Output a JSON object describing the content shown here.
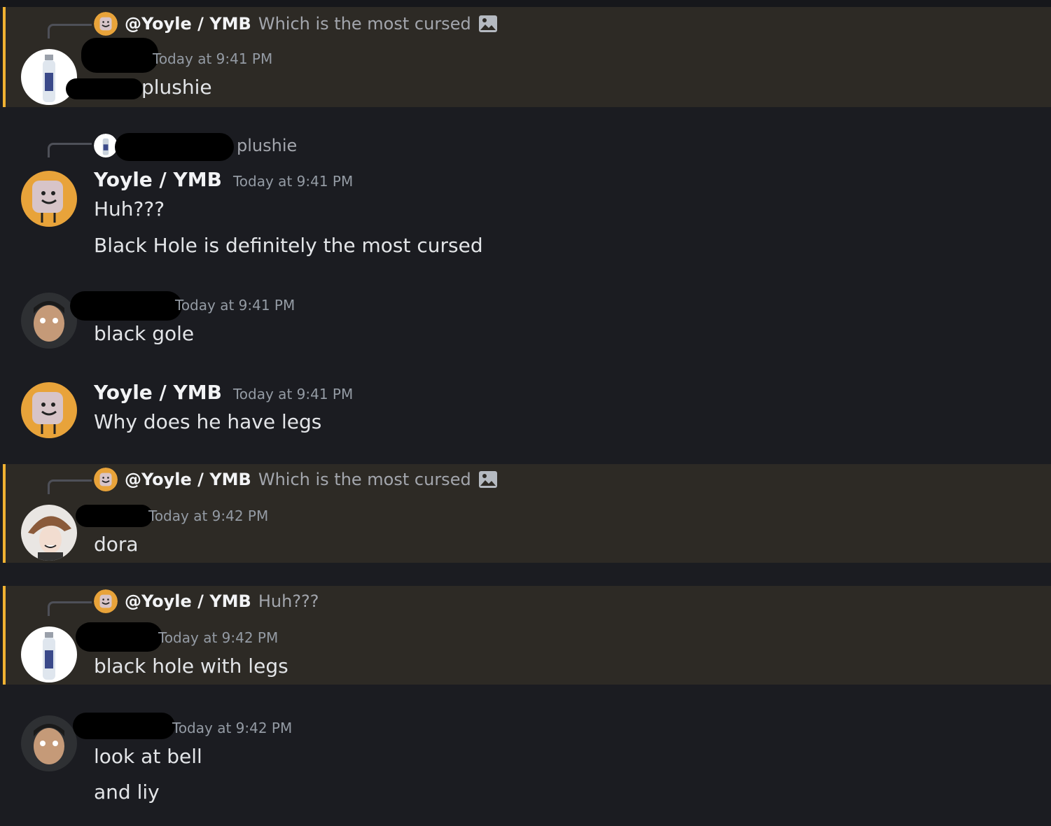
{
  "messages": [
    {
      "reply": {
        "mention": "@Yoyle / YMB",
        "text": "Which is the most cursed",
        "attachment_icon": "image-icon"
      },
      "timestamp": "Today at 9:41 PM",
      "lines": [
        "plushie"
      ],
      "highlighted": true,
      "avatar": "water-bottle-avatar"
    },
    {
      "reply": {
        "text": "plushie"
      },
      "author": "Yoyle / YMB",
      "timestamp": "Today at 9:41 PM",
      "lines": [
        "Huh???",
        "Black Hole is definitely the most cursed"
      ],
      "avatar": "yoyle-avatar"
    },
    {
      "timestamp": "Today at 9:41 PM",
      "lines": [
        "black gole"
      ],
      "avatar": "person-avatar"
    },
    {
      "author": "Yoyle / YMB",
      "timestamp": "Today at 9:41 PM",
      "lines": [
        "Why does he have legs"
      ],
      "avatar": "yoyle-avatar"
    },
    {
      "reply": {
        "mention": "@Yoyle / YMB",
        "text": "Which is the most cursed",
        "attachment_icon": "image-icon"
      },
      "timestamp": "Today at 9:42 PM",
      "lines": [
        "dora"
      ],
      "highlighted": true,
      "avatar": "anime-avatar"
    },
    {
      "reply": {
        "mention": "@Yoyle / YMB",
        "text": "Huh???"
      },
      "timestamp": "Today at 9:42 PM",
      "lines": [
        "black hole with legs"
      ],
      "highlighted": true,
      "avatar": "water-bottle-avatar"
    },
    {
      "timestamp": "Today at 9:42 PM",
      "lines": [
        "look at bell",
        "and liy"
      ],
      "avatar": "person-avatar"
    }
  ],
  "colors": {
    "background": "#1b1c21",
    "mention_highlight": "#2d2a25",
    "mention_bar": "#f0b232",
    "timestamp": "#949ba4"
  }
}
